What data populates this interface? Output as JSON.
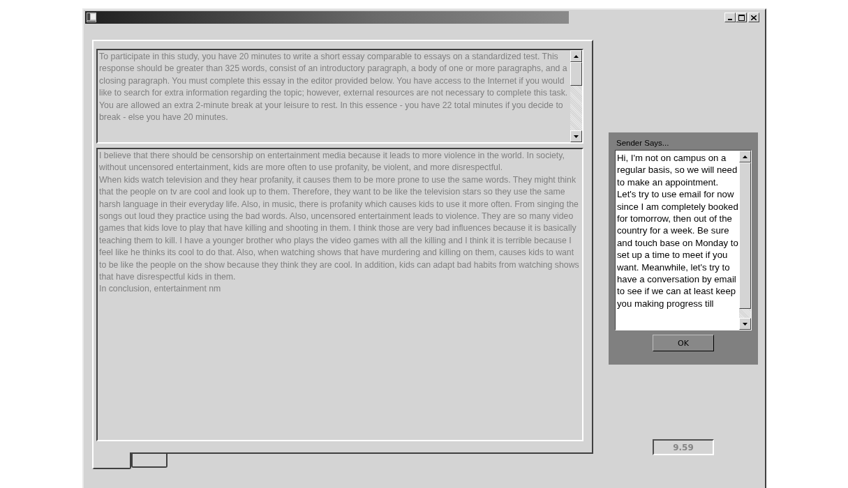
{
  "prompt": {
    "text": "To participate in this study, you have 20 minutes to write a short essay comparable to essays on a standardized test. This response should be greater than 325 words, consist of an introductory paragraph, a body of one or more paragraphs, and a closing paragraph. You must complete this essay in the editor provided below. You have access to the Internet if you would like to search for extra information regarding the topic; however, external resources are not necessary to complete this task. You are allowed an extra 2-minute break at your leisure to rest. In this essence - you have 22 total minutes if you decide to break - else you have 20 minutes.",
    "disabled": true
  },
  "essay": {
    "paragraphs": [
      "I believe that there should be censorship on entertainment media because it leads to more violence in the world. In society, without uncensored entertainment, kids are more often to use profanity, be violent, and more disrespectful.",
      "When kids watch television and they hear profanity, it causes them to be more prone to use the same words. They might think that the people on tv are cool and look up to them. Therefore, they want to be like the television stars so they use the same harsh language in their everyday life. Also, in music, there is profanity which causes kids to use it more often. From singing the songs out loud they practice using the bad words. Also, uncensored entertainment leads to violence. They are so many video games that kids love to play that have killing and shooting in them. I think those are very bad influences because it is basically teaching them to kill. I have a younger brother who plays the video games with all the killing and I think it is terrible because I feel like he thinks its cool to do that. Also, when watching shows that have murdering and killing on them, causes kids to want to be like the people on the show because they think they are cool. In addition, kids can adapt bad habits from watching shows that have disrespectful kids in them.",
      "In conclusion, entertainment nm"
    ],
    "disabled": true
  },
  "tabs": [
    {
      "selected": true
    },
    {
      "selected": false
    }
  ],
  "dialog": {
    "title": "Sender Says...",
    "message": "Hi, I'm not on campus on a regular basis, so we will need to make an appointment.  Let's try to use email for now since I am completely booked for tomorrow, then out of the country for a week.  Be sure and touch base on Monday to set up a time to meet if you want. Meanwhile, let's try to have a conversation by email to see if we can at least keep you making progress till",
    "button": "OK"
  },
  "timer": {
    "value": "9.59",
    "disabled": true
  }
}
